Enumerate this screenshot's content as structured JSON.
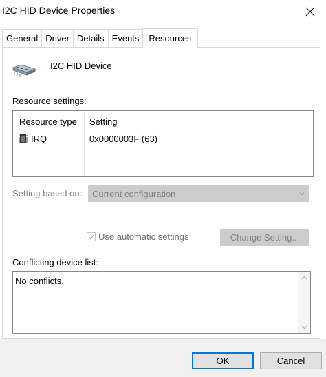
{
  "window": {
    "title": "I2C HID Device Properties"
  },
  "tabs": [
    {
      "label": "General"
    },
    {
      "label": "Driver"
    },
    {
      "label": "Details"
    },
    {
      "label": "Events"
    },
    {
      "label": "Resources",
      "active": true
    }
  ],
  "device": {
    "name": "I2C HID Device",
    "icon": "hid-device-icon"
  },
  "resources": {
    "section_label": "Resource settings:",
    "columns": [
      "Resource type",
      "Setting"
    ],
    "rows": [
      {
        "type": "IRQ",
        "setting": "0x0000003F (63)",
        "icon": "irq-chip-icon"
      }
    ]
  },
  "setting_based_on": {
    "label": "Setting based on:",
    "value": "Current configuration"
  },
  "auto_settings": {
    "label": "Use automatic settings",
    "checked": true
  },
  "change_setting_button": "Change Setting...",
  "conflicts": {
    "label": "Conflicting device list:",
    "text": "No conflicts."
  },
  "footer": {
    "ok": "OK",
    "cancel": "Cancel"
  }
}
